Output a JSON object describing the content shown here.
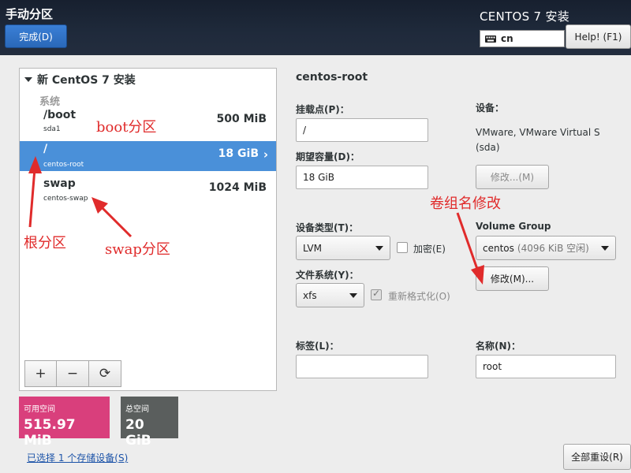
{
  "header": {
    "page_title": "手动分区",
    "done_label": "完成(D)",
    "product_title": "CENTOS 7 安装",
    "keyboard_layout": "cn",
    "help_label": "Help! (F1)"
  },
  "partition_tree": {
    "header": "新 CentOS 7 安装",
    "group_label": "系统",
    "partitions": [
      {
        "mount": "/boot",
        "device": "sda1",
        "size": "500 MiB",
        "selected": false
      },
      {
        "mount": "/",
        "device": "centos-root",
        "size": "18 GiB",
        "selected": true
      },
      {
        "mount": "swap",
        "device": "centos-swap",
        "size": "1024 MiB",
        "selected": false
      }
    ],
    "buttons": {
      "add": "+",
      "remove": "−",
      "refresh": "⟳"
    }
  },
  "space": {
    "available_label": "可用空间",
    "available_value": "515.97 MiB",
    "total_label": "总空间",
    "total_value": "20 GiB"
  },
  "selected_devices_link": "已选择 1 个存储设备(S)",
  "details": {
    "title": "centos-root",
    "mount_point_label": "挂载点(P)：",
    "mount_point_value": "/",
    "capacity_label": "期望容量(D)：",
    "capacity_value": "18 GiB",
    "device_label": "设备：",
    "device_value_line1": "VMware, VMware Virtual S",
    "device_value_line2": "(sda)",
    "modify_device_label": "修改...(M)",
    "device_type_label": "设备类型(T)：",
    "device_type_value": "LVM",
    "encrypt_label": "加密(E)",
    "filesystem_label": "文件系统(Y)：",
    "filesystem_value": "xfs",
    "reformat_label": "重新格式化(O)",
    "volume_group_label": "Volume Group",
    "volume_group_value": "centos",
    "volume_group_free": "(4096 KiB 空闲)",
    "modify_vg_label": "修改(M)...",
    "tag_label": "标签(L)：",
    "tag_value": "",
    "name_label": "名称(N)：",
    "name_value": "root"
  },
  "reset_all_label": "全部重设(R)",
  "annotations": {
    "boot": "boot分区",
    "root": "根分区",
    "swap": "swap分区",
    "vg": "卷组名修改"
  },
  "colors": {
    "header_bg": "#1f2a3b",
    "selected_row": "#4a90d9",
    "available_space": "#d93f7c",
    "total_space": "#5a5e5d",
    "annotation_red": "#e02b2b",
    "link_blue": "#1c53a8"
  }
}
